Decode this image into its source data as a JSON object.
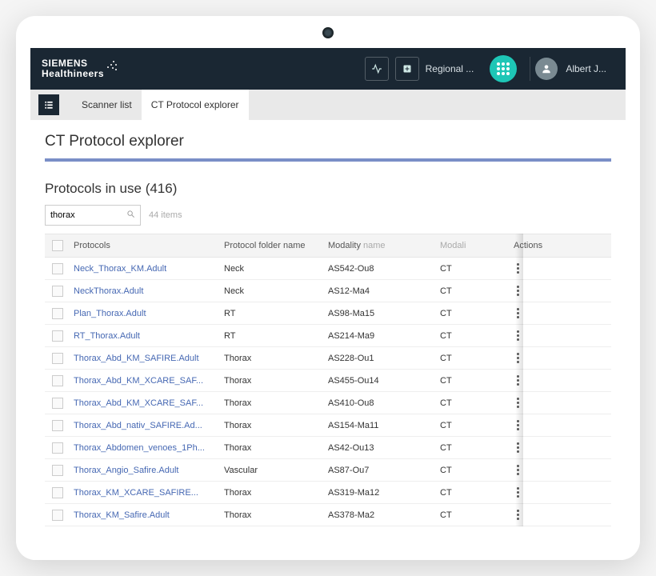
{
  "brand": {
    "line1": "SIEMENS",
    "line2": "Healthineers"
  },
  "header": {
    "regional_label": "Regional ...",
    "user_name": "Albert J..."
  },
  "tabs": {
    "scanner_list": "Scanner list",
    "protocol_explorer": "CT Protocol explorer"
  },
  "page_title": "CT Protocol explorer",
  "section": {
    "heading_prefix": "Protocols in use ",
    "heading_count": "(416)",
    "search_value": "thorax",
    "items_label": "44 items"
  },
  "columns": {
    "protocols": "Protocols",
    "folder": "Protocol folder name",
    "modality_prefix": "Modality",
    "modality_suffix": " name",
    "modality2": "Modali",
    "actions": "Actions"
  },
  "rows": [
    {
      "name": "Neck_Thorax_KM.Adult",
      "folder": "Neck",
      "modname": "AS542-Ou8",
      "mod": "CT"
    },
    {
      "name": "NeckThorax.Adult",
      "folder": "Neck",
      "modname": "AS12-Ma4",
      "mod": "CT"
    },
    {
      "name": "Plan_Thorax.Adult",
      "folder": "RT",
      "modname": "AS98-Ma15",
      "mod": "CT"
    },
    {
      "name": "RT_Thorax.Adult",
      "folder": "RT",
      "modname": "AS214-Ma9",
      "mod": "CT"
    },
    {
      "name": "Thorax_Abd_KM_SAFIRE.Adult",
      "folder": "Thorax",
      "modname": "AS228-Ou1",
      "mod": "CT"
    },
    {
      "name": "Thorax_Abd_KM_XCARE_SAF...",
      "folder": "Thorax",
      "modname": "AS455-Ou14",
      "mod": "CT"
    },
    {
      "name": "Thorax_Abd_KM_XCARE_SAF...",
      "folder": "Thorax",
      "modname": "AS410-Ou8",
      "mod": "CT"
    },
    {
      "name": "Thorax_Abd_nativ_SAFIRE.Ad...",
      "folder": "Thorax",
      "modname": "AS154-Ma11",
      "mod": "CT"
    },
    {
      "name": "Thorax_Abdomen_venoes_1Ph...",
      "folder": "Thorax",
      "modname": "AS42-Ou13",
      "mod": "CT"
    },
    {
      "name": "Thorax_Angio_Safire.Adult",
      "folder": "Vascular",
      "modname": "AS87-Ou7",
      "mod": "CT"
    },
    {
      "name": "Thorax_KM_XCARE_SAFIRE...",
      "folder": "Thorax",
      "modname": "AS319-Ma12",
      "mod": "CT"
    },
    {
      "name": "Thorax_KM_Safire.Adult",
      "folder": "Thorax",
      "modname": "AS378-Ma2",
      "mod": "CT"
    }
  ]
}
